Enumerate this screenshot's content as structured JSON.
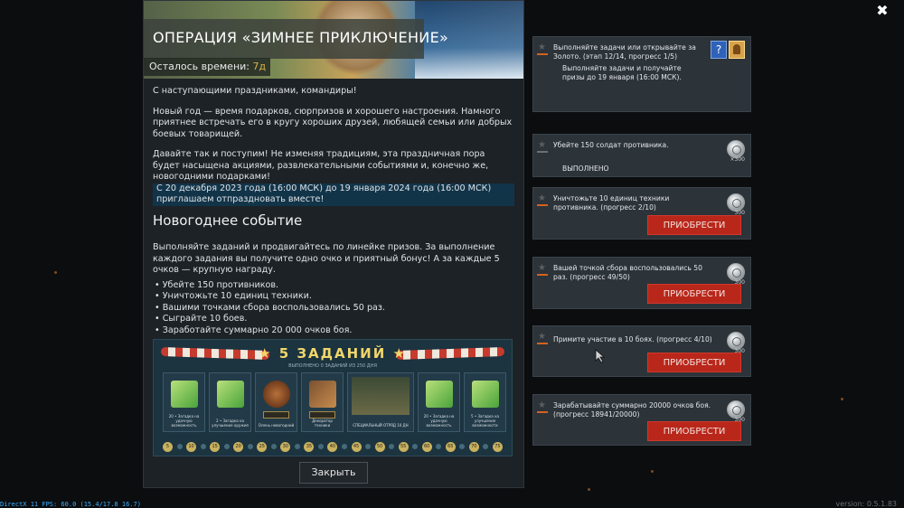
{
  "window": {
    "close_glyph": "✖"
  },
  "event": {
    "title": "ОПЕРАЦИЯ «ЗИМНЕЕ ПРИКЛЮЧЕНИЕ»",
    "time_label": "Осталось времени:",
    "time_value": "7д",
    "paragraphs": [
      "С наступающими праздниками, командиры!",
      "Новый год — время подарков, сюрпризов и хорошего настроения. Намного приятнее встречать его в кругу хороших друзей, любящей семьи или добрых боевых товарищей.",
      "Давайте так и поступим! Не изменяя традициям, эта праздничная пора будет насыщена акциями, развлекательными событиями и, конечно же, новогодними подарками!"
    ],
    "highlight": "С 20 декабря 2023 года (16:00 МСК) до 19 января 2024 года (16:00 МСК) приглашаем отпраздновать вместе!",
    "section_title": "Новогоднее событие",
    "section_intro": "Выполняйте заданий и продвигайтесь по линейке призов. За выполнение каждого задания вы получите одно очко и приятный бонус! А за каждые 5 очков — крупную награду.",
    "bullets": [
      "• Убейте 150 противников.",
      "• Уничтожьте 10 единиц техники.",
      "• Вашими точками сбора воспользовались 50 раз.",
      "• Сыграйте 10 боев.",
      "• Заработайте суммарно 20 000 очков боя."
    ],
    "promo": {
      "title": "★ 5 ЗАДАНИЙ ★",
      "subtitle": "ВЫПОЛНЕНО 0 ЗАДАНИЙ ИЗ 250 ДНЯ",
      "tiles": [
        {
          "caption": "20 • Загадка на удачную возможность"
        },
        {
          "caption": "2 • Загадка на улучшение оружия"
        },
        {
          "caption": "Олень новогодний"
        },
        {
          "caption": "Декоратор техники"
        },
        {
          "caption": "СПЕЦИАЛЬНЫЙ ОТРЯД 10 ДН"
        },
        {
          "caption": "20 • Загадка на удачную возможность"
        },
        {
          "caption": "5 • Загадка на улучшение возможности"
        }
      ],
      "track": [
        "5",
        "10",
        "15",
        "20",
        "25",
        "30",
        "35",
        "40",
        "45",
        "50",
        "55",
        "60",
        "65",
        "70",
        "75"
      ]
    },
    "close_button": "Закрыть"
  },
  "tasks": [
    {
      "text": "Выполняйте задачи или открывайте за Золото. (этап 12/14, прогресс 1/5)",
      "extra": "Выполняйте задачи и получайте призы до 19 января (16:00 МСК).",
      "help_glyph": "?"
    },
    {
      "text": "Убейте 150 солдат противника.",
      "status": "ВЫПОЛНЕНО",
      "reward": "×300"
    },
    {
      "text": "Уничтожьте 10 единиц техники противника. (прогресс 2/10)",
      "reward": "300",
      "button": "ПРИОБРЕСТИ"
    },
    {
      "text": "Вашей точкой сбора воспользовались 50 раз. (прогресс 49/50)",
      "reward": "300",
      "button": "ПРИОБРЕСТИ"
    },
    {
      "text": "Примите участие в 10 боях. (прогресс 4/10)",
      "reward": "300",
      "button": "ПРИОБРЕСТИ"
    },
    {
      "text": "Зарабатывайте суммарно 20000 очков боя. (прогресс 18941/20000)",
      "reward": "300",
      "button": "ПРИОБРЕСТИ"
    }
  ],
  "footer": {
    "fps": "DirectX 11 FPS: 60.0 (15.4/17.8 16.7)",
    "version": "version: 0.5.1.83"
  },
  "colors": {
    "accent_gold": "#d6b24b",
    "buy_red": "#b8271a",
    "panel": "#1d2226"
  }
}
